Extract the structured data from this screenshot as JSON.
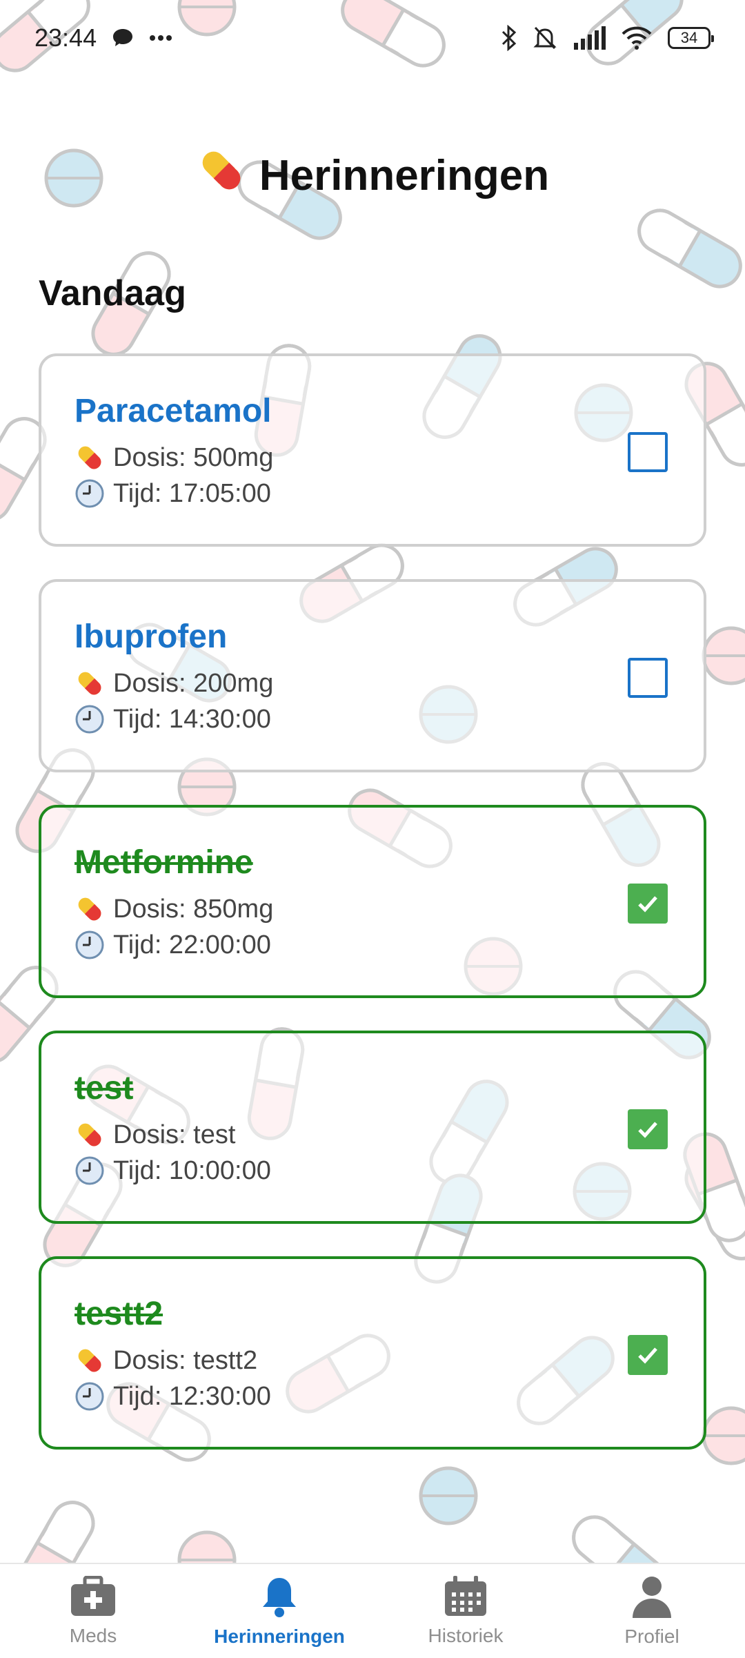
{
  "status_bar": {
    "time": "23:44",
    "icons": [
      "chat-bubble-icon",
      "more-dots-icon",
      "bluetooth-icon",
      "bell-off-icon",
      "signal-icon",
      "wifi-icon"
    ],
    "battery_level": "34"
  },
  "header": {
    "icon": "pill-icon",
    "title": "Herinneringen"
  },
  "section_title": "Vandaag",
  "reminders": [
    {
      "name": "Paracetamol",
      "dose": "Dosis: 500mg",
      "time": "Tijd: 17:05:00",
      "taken": false
    },
    {
      "name": "Ibuprofen",
      "dose": "Dosis: 200mg",
      "time": "Tijd: 14:30:00",
      "taken": false
    },
    {
      "name": "Metformine",
      "dose": "Dosis: 850mg",
      "time": "Tijd: 22:00:00",
      "taken": true
    },
    {
      "name": "test",
      "dose": "Dosis: test",
      "time": "Tijd: 10:00:00",
      "taken": true
    },
    {
      "name": "testt2",
      "dose": "Dosis: testt2",
      "time": "Tijd: 12:30:00",
      "taken": true
    }
  ],
  "tabs": [
    {
      "label": "Meds",
      "icon": "medkit-icon",
      "active": false
    },
    {
      "label": "Herinneringen",
      "icon": "bell-icon",
      "active": true
    },
    {
      "label": "Historiek",
      "icon": "calendar-icon",
      "active": false
    },
    {
      "label": "Profiel",
      "icon": "person-icon",
      "active": false
    }
  ],
  "colors": {
    "accent": "#1a73c8",
    "done_green": "#1e8a1e",
    "checkbox_green": "#4caf50",
    "card_border": "#cfcfcf",
    "tab_inactive": "#8e8e8e"
  }
}
